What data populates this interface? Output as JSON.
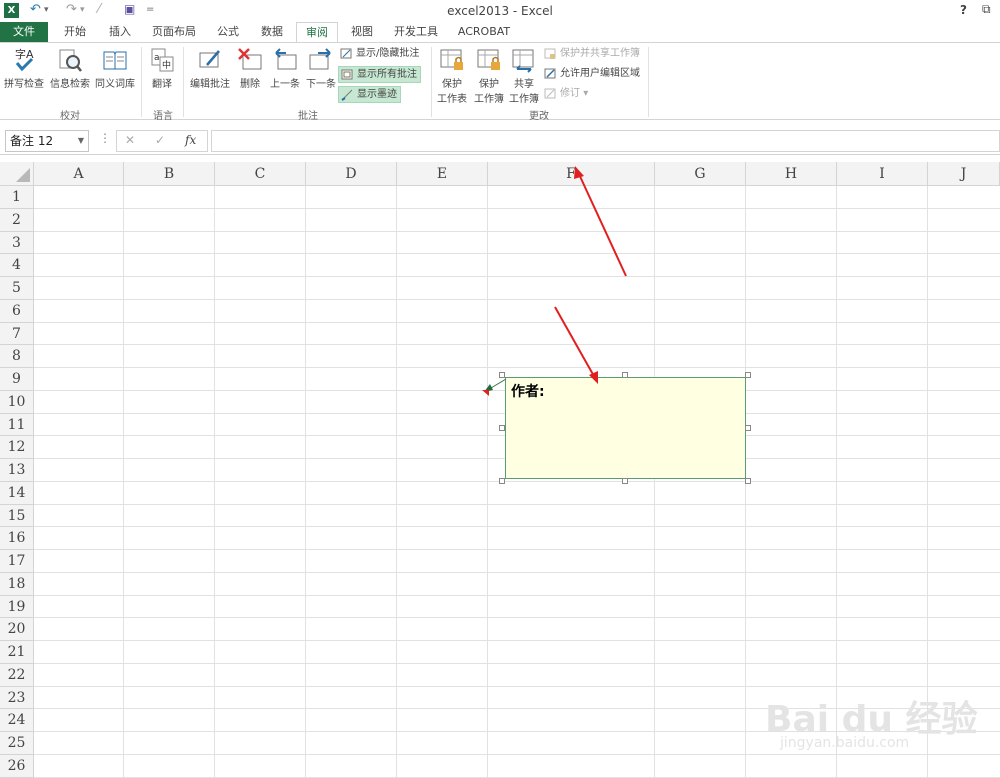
{
  "window": {
    "title": "excel2013 - Excel",
    "help": "?",
    "restore": "⧉",
    "logo": "X"
  },
  "quick_access": {
    "undo": "↶",
    "redo": "↷",
    "customize": "⌄",
    "save": "💾",
    "more": "="
  },
  "tabs": [
    {
      "label": "文件"
    },
    {
      "label": "开始"
    },
    {
      "label": "插入"
    },
    {
      "label": "页面布局"
    },
    {
      "label": "公式"
    },
    {
      "label": "数据"
    },
    {
      "label": "审阅"
    },
    {
      "label": "视图"
    },
    {
      "label": "开发工具"
    },
    {
      "label": "ACROBAT"
    }
  ],
  "ribbon": {
    "groups": {
      "proofing": "校对",
      "language": "语言",
      "comments": "批注",
      "changes": "更改"
    },
    "buttons": {
      "spell": "拼写检查",
      "research": "信息检索",
      "thesaurus": "同义词库",
      "translate": "翻译",
      "edit_comment": "编辑批注",
      "delete": "删除",
      "prev": "上一条",
      "next": "下一条",
      "protect_sheet_1": "保护",
      "protect_sheet_2": "工作表",
      "protect_wb_1": "保护",
      "protect_wb_2": "工作簿",
      "share_wb_1": "共享",
      "share_wb_2": "工作簿"
    },
    "small": {
      "show_hide": "显示/隐藏批注",
      "show_all": "显示所有批注",
      "show_ink": "显示墨迹",
      "protect_share": "保护并共享工作簿",
      "allow_edit": "允许用户编辑区域",
      "track": "修订"
    }
  },
  "formula_bar": {
    "name_box": "备注 12",
    "dots": "⋮",
    "cancel": "✕",
    "enter": "✓",
    "fx": "fx",
    "value": ""
  },
  "columns": [
    "A",
    "B",
    "C",
    "D",
    "E",
    "F",
    "G",
    "H",
    "I",
    "J"
  ],
  "rows": [
    "1",
    "2",
    "3",
    "4",
    "5",
    "6",
    "7",
    "8",
    "9",
    "10",
    "11",
    "12",
    "13",
    "14",
    "15",
    "16",
    "17",
    "18",
    "19",
    "20",
    "21",
    "22",
    "23",
    "24",
    "25",
    "26"
  ],
  "comment": {
    "author": "作者:"
  },
  "watermark": {
    "main": "Bai du 经验",
    "sub": "jingyan.baidu.com"
  },
  "colors": {
    "accent": "#217346",
    "comment_bg": "#ffffe1",
    "highlight": "#c6e8d2",
    "arrow": "#e02020"
  }
}
